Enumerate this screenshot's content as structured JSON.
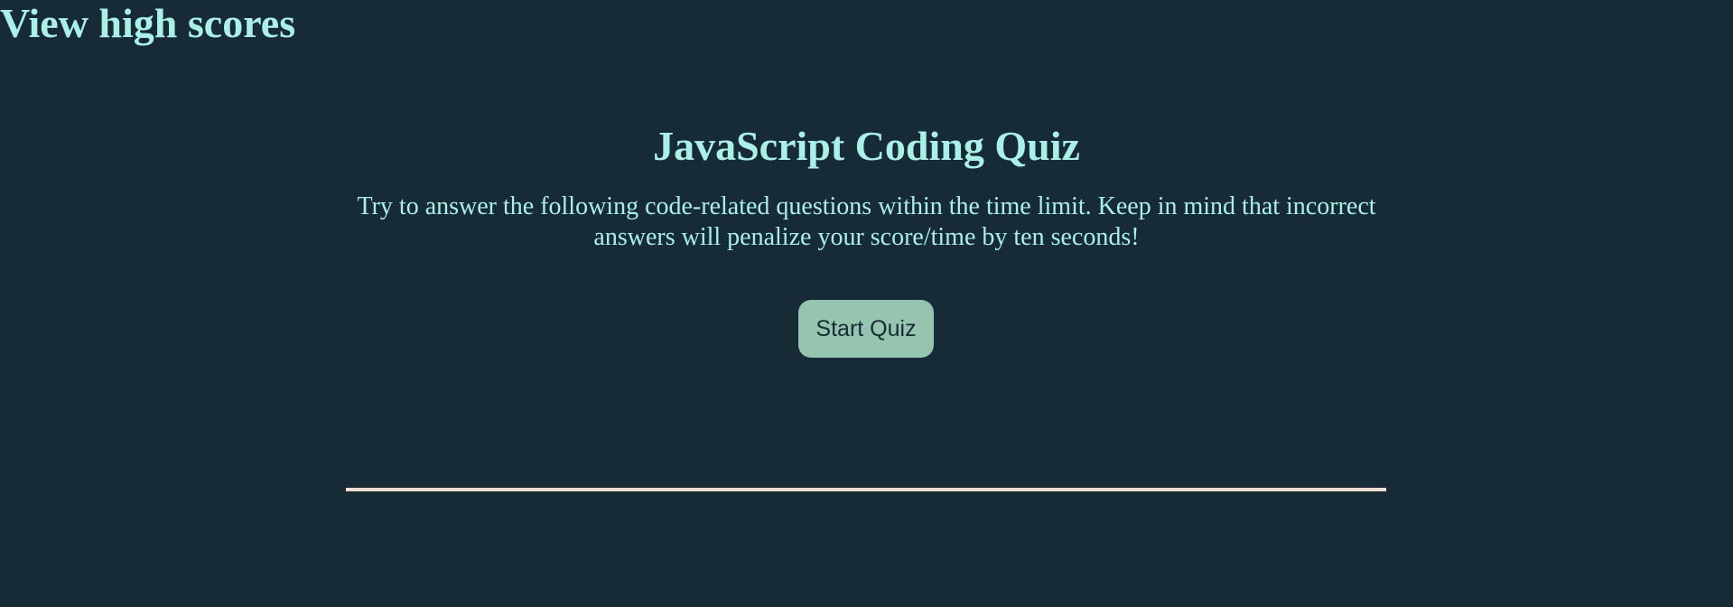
{
  "header": {
    "high_scores_link": "View high scores"
  },
  "quiz": {
    "title": "JavaScript Coding Quiz",
    "intro": "Try to answer the following code-related questions within the time limit. Keep in mind that incorrect answers will penalize your score/time by ten seconds!",
    "start_button_label": "Start Quiz"
  },
  "colors": {
    "background": "#172b36",
    "text": "#aaf0e8",
    "button": "#96c4b0",
    "divider": "#f5ddd0"
  }
}
